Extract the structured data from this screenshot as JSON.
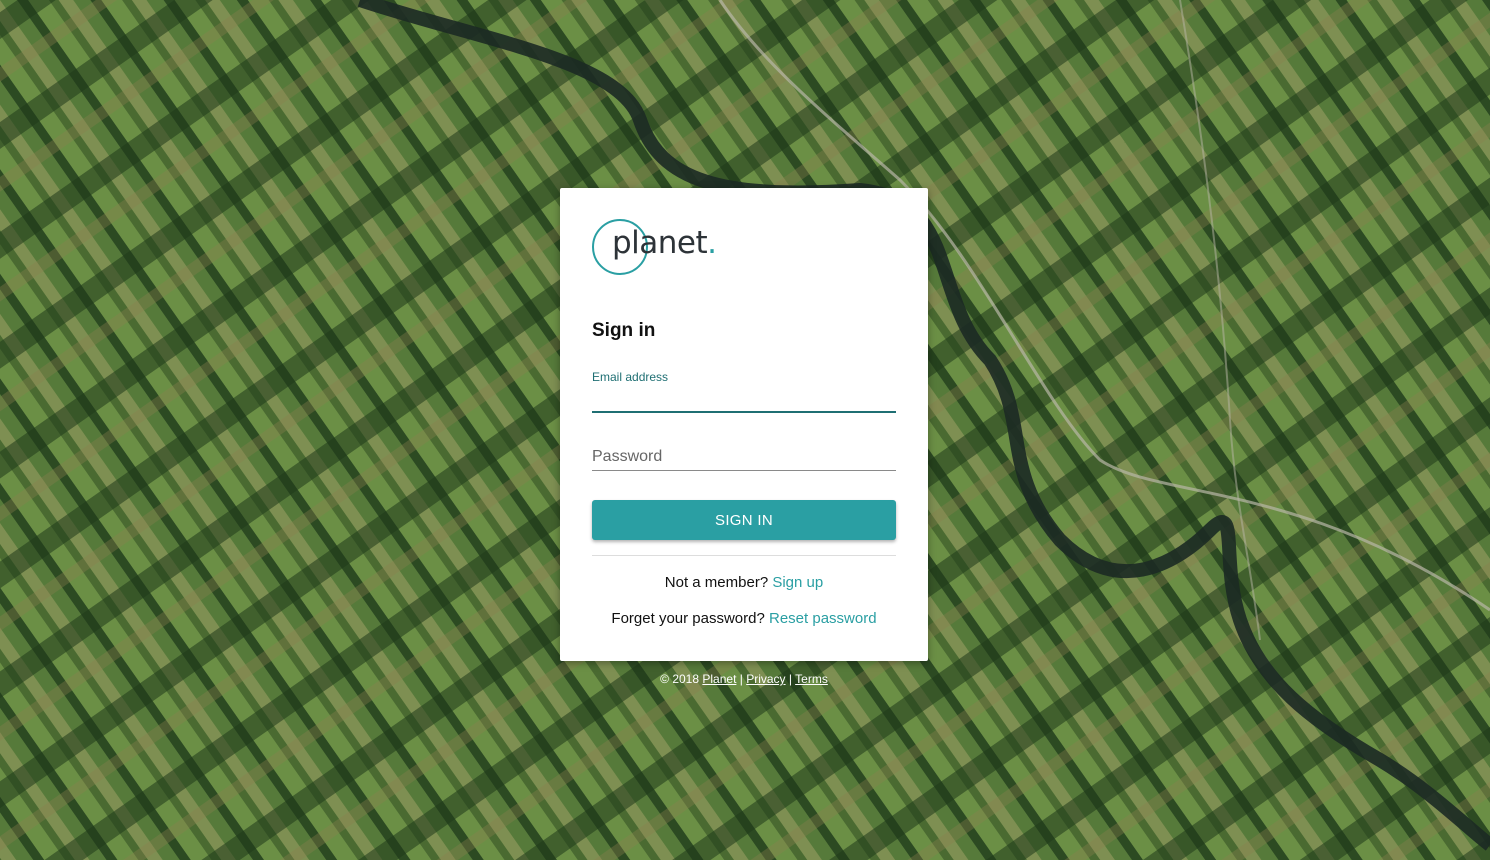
{
  "brand": {
    "logo_text": "planet",
    "logo_dot": ".",
    "accent_color": "#2a9fa3",
    "logo_icon": "planet-logo-icon"
  },
  "form": {
    "title": "Sign in",
    "email_label": "Email address",
    "email_value": "",
    "password_placeholder": "Password",
    "password_value": "",
    "submit_label": "SIGN IN"
  },
  "links": {
    "member_prompt": "Not a member?",
    "signup_label": "Sign up",
    "forgot_prompt": "Forget your password?",
    "reset_label": "Reset password"
  },
  "footer": {
    "copyright": "© 2018",
    "planet_link": "Planet",
    "separator": "|",
    "privacy_link": "Privacy",
    "terms_link": "Terms"
  },
  "background": {
    "type": "aerial-farmland-satellite-image"
  }
}
